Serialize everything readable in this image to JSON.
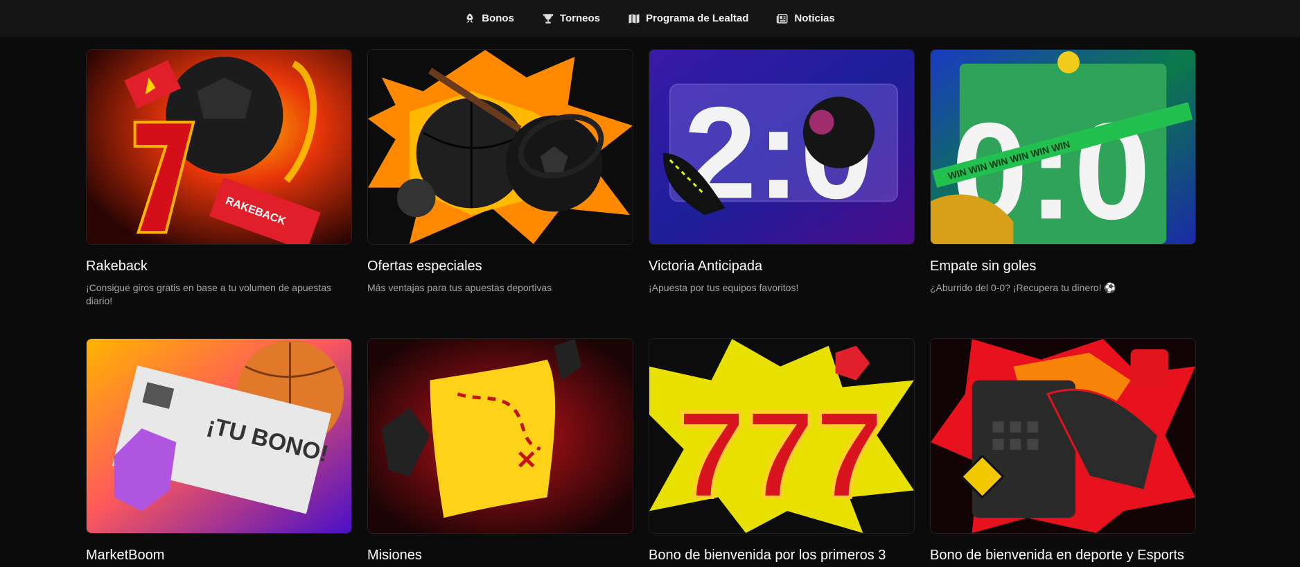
{
  "nav": {
    "items": [
      {
        "label": "Bonos",
        "icon": "rocket-icon"
      },
      {
        "label": "Torneos",
        "icon": "trophy-icon"
      },
      {
        "label": "Programa de Lealtad",
        "icon": "map-icon"
      },
      {
        "label": "Noticias",
        "icon": "newspaper-icon"
      }
    ]
  },
  "cards": [
    {
      "title": "Rakeback",
      "desc": "¡Consigue giros gratis en base a tu volumen de apuestas diario!",
      "art_text": "RAKEBACK"
    },
    {
      "title": "Ofertas especiales",
      "desc": "Más ventajas para tus apuestas deportivas"
    },
    {
      "title": "Victoria Anticipada",
      "desc": "¡Apuesta por tus equipos favoritos!",
      "art_text": "2:0"
    },
    {
      "title": "Empate sin goles",
      "desc": "¿Aburrido del 0-0? ¡Recupera tu dinero! ⚽",
      "art_text": "0:0",
      "art_band": "WIN WIN WIN WIN WIN WIN"
    },
    {
      "title": "MarketBoom",
      "desc": "",
      "art_text": "¡TU BONO!"
    },
    {
      "title": "Misiones",
      "desc": ""
    },
    {
      "title": "Bono de bienvenida por los primeros 3",
      "desc": "",
      "art_text": "777"
    },
    {
      "title": "Bono de bienvenida en deporte y Esports",
      "desc": ""
    }
  ],
  "colors": {
    "background": "#0b0b0b",
    "nav_bg": "#151515",
    "desc_text": "#a6a6a6"
  }
}
